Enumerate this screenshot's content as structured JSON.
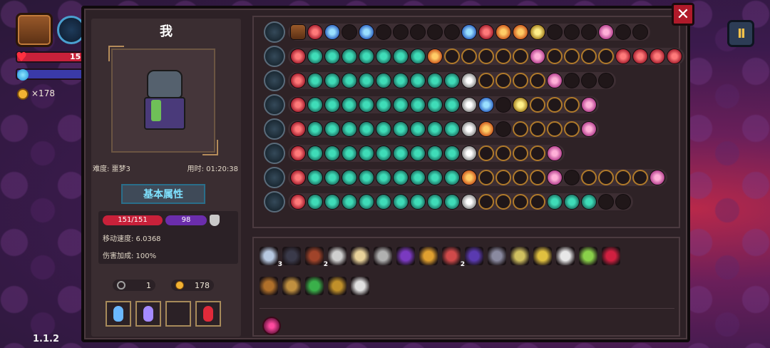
{
  "hud": {
    "hp_value": "15",
    "coins": "×178",
    "version": "1.1.2",
    "pause_label": "II"
  },
  "panel": {
    "close_label": "✕",
    "player_name": "我",
    "difficulty": "难度: 噩梦3",
    "time": "用时: 01:20:38",
    "attr_title": "基本属性",
    "hp": "151/151",
    "mp": "98",
    "move_speed": "移动速度: 6.0368",
    "damage_bonus": "伤害加成: 100%",
    "keys": "1",
    "coins": "178"
  },
  "weapon_rows": [
    {
      "name": "row-0",
      "slots": [
        "chest",
        "red",
        "blue",
        "",
        "blue",
        "",
        "",
        "",
        "",
        "",
        "blue",
        "red",
        "orange",
        "orange",
        "yellow",
        "",
        "",
        "",
        "pink",
        "",
        ""
      ]
    },
    {
      "name": "row-1",
      "slots": [
        "red",
        "teal",
        "teal",
        "teal",
        "teal",
        "teal",
        "teal",
        "teal",
        "orange",
        "ring",
        "ring",
        "ring",
        "ring",
        "ring",
        "pink",
        "ring",
        "ring",
        "ring",
        "ring",
        "red",
        "red",
        "red",
        "red"
      ]
    },
    {
      "name": "row-2",
      "slots": [
        "red",
        "teal",
        "teal",
        "teal",
        "teal",
        "teal",
        "teal",
        "teal",
        "teal",
        "teal",
        "white",
        "ring",
        "ring",
        "ring",
        "ring",
        "pink",
        "",
        "",
        ""
      ]
    },
    {
      "name": "row-3",
      "slots": [
        "red",
        "teal",
        "teal",
        "teal",
        "teal",
        "teal",
        "teal",
        "teal",
        "teal",
        "teal",
        "white",
        "blue",
        "",
        "yellow",
        "ring",
        "ring",
        "ring",
        "pink"
      ]
    },
    {
      "name": "row-4",
      "slots": [
        "red",
        "teal",
        "teal",
        "teal",
        "teal",
        "teal",
        "teal",
        "teal",
        "teal",
        "teal",
        "white",
        "orange",
        "",
        "ring",
        "ring",
        "ring",
        "ring",
        "pink"
      ]
    },
    {
      "name": "row-5",
      "slots": [
        "red",
        "teal",
        "teal",
        "teal",
        "teal",
        "teal",
        "teal",
        "teal",
        "teal",
        "teal",
        "white",
        "ring",
        "ring",
        "ring",
        "ring",
        "pink"
      ]
    },
    {
      "name": "row-6",
      "slots": [
        "red",
        "teal",
        "teal",
        "teal",
        "teal",
        "teal",
        "teal",
        "teal",
        "teal",
        "teal",
        "orange",
        "ring",
        "ring",
        "ring",
        "ring",
        "pink",
        "",
        "ring",
        "ring",
        "ring",
        "ring",
        "pink"
      ]
    },
    {
      "name": "row-7",
      "slots": [
        "red",
        "teal",
        "teal",
        "teal",
        "teal",
        "teal",
        "teal",
        "teal",
        "teal",
        "teal",
        "white",
        "ring",
        "ring",
        "ring",
        "ring",
        "teal",
        "teal",
        "teal",
        "",
        ""
      ]
    }
  ],
  "items_row1": [
    {
      "icon": "shield-icon",
      "count": "3",
      "color": "#b7c8e0"
    },
    {
      "icon": "dark-orb-icon",
      "count": "",
      "color": "#3a3a4a"
    },
    {
      "icon": "tree-icon",
      "count": "2",
      "color": "#a0442a"
    },
    {
      "icon": "armor-icon",
      "count": "",
      "color": "#cfcfcf"
    },
    {
      "icon": "bread-icon",
      "count": "",
      "color": "#e8d29a"
    },
    {
      "icon": "gauntlet-icon",
      "count": "",
      "color": "#b0b0b0"
    },
    {
      "icon": "wizard-hat-icon",
      "count": "",
      "color": "#7a3ac0"
    },
    {
      "icon": "chalice-icon",
      "count": "",
      "color": "#e0a030"
    },
    {
      "icon": "potion-bag-icon",
      "count": "2",
      "color": "#d04a4a"
    },
    {
      "icon": "cape-icon",
      "count": "",
      "color": "#5a3ab0"
    },
    {
      "icon": "robe-icon",
      "count": "",
      "color": "#8a8aa0"
    },
    {
      "icon": "snake-icon",
      "count": "",
      "color": "#d0c060"
    },
    {
      "icon": "crown-icon",
      "count": "",
      "color": "#e0c040"
    },
    {
      "icon": "bone-icon",
      "count": "",
      "color": "#e8e8e8"
    },
    {
      "icon": "herb-icon",
      "count": "",
      "color": "#8ad04a"
    },
    {
      "icon": "red-wand-icon",
      "count": "",
      "color": "#d02040"
    }
  ],
  "items_row2": [
    {
      "icon": "scroll-icon",
      "count": "",
      "color": "#b0702a"
    },
    {
      "icon": "map-icon",
      "count": "",
      "color": "#c09040"
    },
    {
      "icon": "leaf-icon",
      "count": "",
      "color": "#3ab04a"
    },
    {
      "icon": "hourglass-icon",
      "count": "",
      "color": "#c0902a"
    },
    {
      "icon": "ribcage-icon",
      "count": "",
      "color": "#e0e0e0"
    }
  ]
}
